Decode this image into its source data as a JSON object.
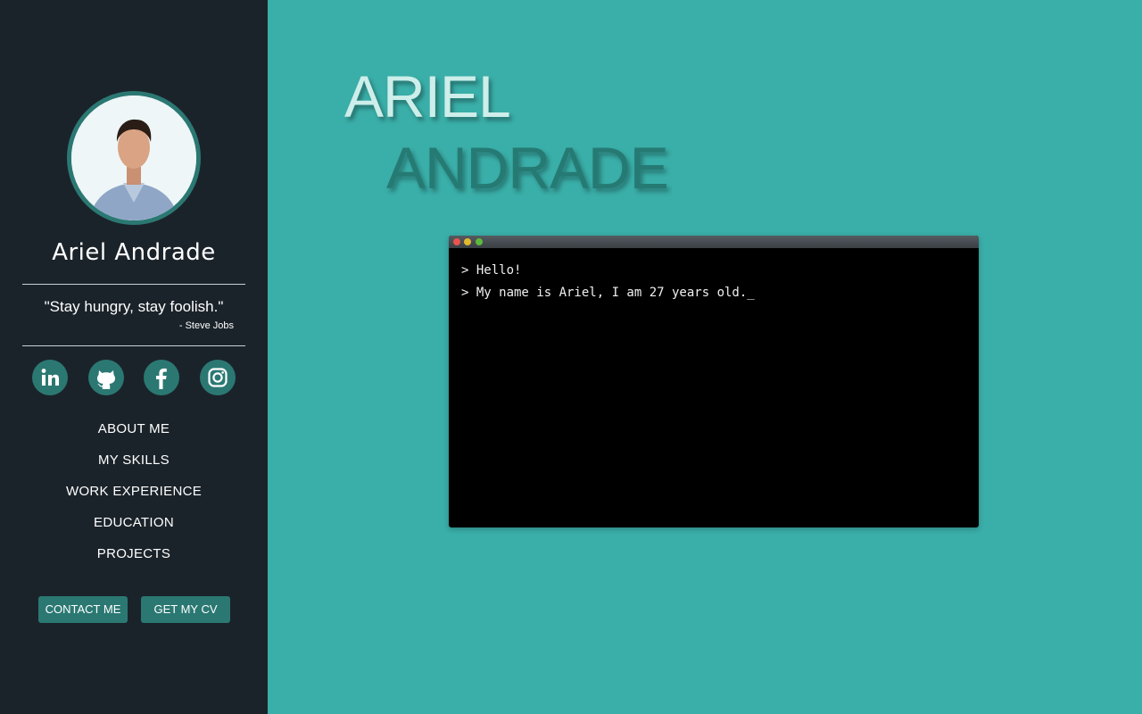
{
  "profile": {
    "name": "Ariel Andrade",
    "quote": "\"Stay hungry, stay foolish.\"",
    "quote_author": "- Steve Jobs"
  },
  "social": [
    {
      "name": "linkedin",
      "icon": "linkedin-icon"
    },
    {
      "name": "github",
      "icon": "github-icon"
    },
    {
      "name": "facebook",
      "icon": "facebook-icon"
    },
    {
      "name": "instagram",
      "icon": "instagram-icon"
    }
  ],
  "nav": {
    "items": [
      {
        "label": "ABOUT ME"
      },
      {
        "label": "MY SKILLS"
      },
      {
        "label": "WORK EXPERIENCE"
      },
      {
        "label": "EDUCATION"
      },
      {
        "label": "PROJECTS"
      }
    ]
  },
  "buttons": {
    "contact": "CONTACT ME",
    "cv": "GET MY CV"
  },
  "hero": {
    "first_name": "ARIEL",
    "last_name": "ANDRADE"
  },
  "terminal": {
    "lines": [
      "> Hello!",
      "> My name is Ariel, I am 27 years old._"
    ]
  },
  "colors": {
    "main_background": "#3aaea8",
    "sidebar_background": "#1b232a",
    "accent": "#2b7873",
    "title_first": "#cdeeea",
    "title_last": "#267a74",
    "terminal_background": "#000000"
  }
}
